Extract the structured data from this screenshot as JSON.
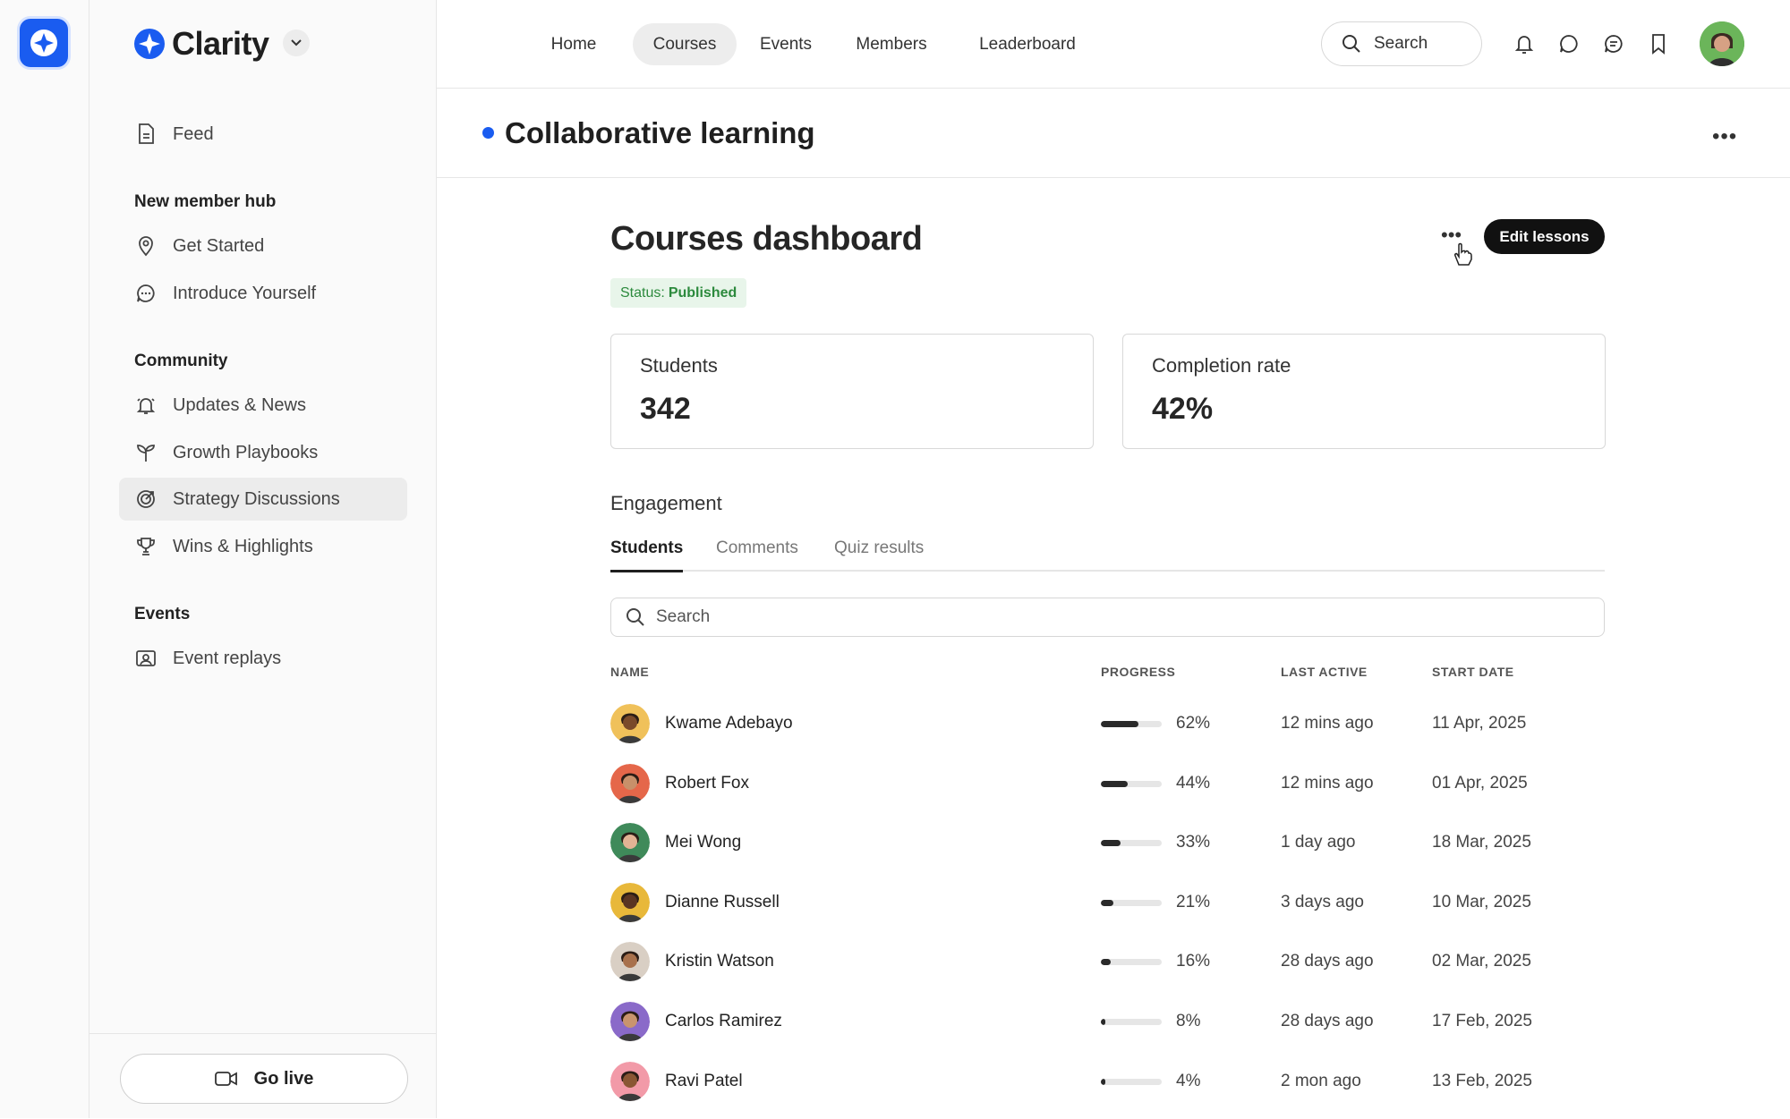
{
  "brand": {
    "name": "Clarity",
    "accent": "#1a5cf0"
  },
  "topnav": {
    "tabs": [
      {
        "label": "Home",
        "active": false
      },
      {
        "label": "Courses",
        "active": true
      },
      {
        "label": "Events",
        "active": false
      },
      {
        "label": "Members",
        "active": false
      },
      {
        "label": "Leaderboard",
        "active": false
      }
    ],
    "search_label": "Search",
    "icons": [
      "bell-icon",
      "chat-icon",
      "messages-icon",
      "bookmark-icon"
    ]
  },
  "sidebar": {
    "feed": "Feed",
    "sections": [
      {
        "title": "New member hub",
        "items": [
          {
            "label": "Get Started",
            "icon": "location-pin-icon"
          },
          {
            "label": "Introduce Yourself",
            "icon": "chat-bubble-icon"
          }
        ]
      },
      {
        "title": "Community",
        "items": [
          {
            "label": "Updates & News",
            "icon": "bell-ring-icon"
          },
          {
            "label": "Growth Playbooks",
            "icon": "sprout-icon"
          },
          {
            "label": "Strategy Discussions",
            "icon": "target-icon",
            "active": true
          },
          {
            "label": "Wins & Highlights",
            "icon": "trophy-icon"
          }
        ]
      },
      {
        "title": "Events",
        "items": [
          {
            "label": "Event replays",
            "icon": "replay-icon"
          }
        ]
      }
    ],
    "go_live": "Go live"
  },
  "page": {
    "title": "Collaborative learning"
  },
  "dashboard": {
    "title": "Courses dashboard",
    "status_prefix": "Status:",
    "status_value": "Published",
    "edit_button": "Edit lessons",
    "stats": [
      {
        "label": "Students",
        "value": "342"
      },
      {
        "label": "Completion rate",
        "value": "42%"
      }
    ],
    "engagement_title": "Engagement",
    "tabs": [
      {
        "label": "Students",
        "active": true
      },
      {
        "label": "Comments",
        "active": false
      },
      {
        "label": "Quiz results",
        "active": false
      }
    ],
    "search_placeholder": "Search",
    "columns": [
      "NAME",
      "PROGRESS",
      "LAST ACTIVE",
      "START DATE"
    ],
    "rows": [
      {
        "name": "Kwame Adebayo",
        "progress": 62,
        "progress_label": "62%",
        "last_active": "12 mins ago",
        "start_date": "11 Apr, 2025",
        "avatar_bg": "#f0c15a",
        "skin": "#7a4a2a"
      },
      {
        "name": "Robert Fox",
        "progress": 44,
        "progress_label": "44%",
        "last_active": "12 mins ago",
        "start_date": "01 Apr, 2025",
        "avatar_bg": "#e5674a",
        "skin": "#c8906a"
      },
      {
        "name": "Mei Wong",
        "progress": 33,
        "progress_label": "33%",
        "last_active": "1 day ago",
        "start_date": "18 Mar, 2025",
        "avatar_bg": "#3f8a5a",
        "skin": "#e2b394"
      },
      {
        "name": "Dianne Russell",
        "progress": 21,
        "progress_label": "21%",
        "last_active": "3 days ago",
        "start_date": "10 Mar, 2025",
        "avatar_bg": "#e8b83a",
        "skin": "#5a3522"
      },
      {
        "name": "Kristin Watson",
        "progress": 16,
        "progress_label": "16%",
        "last_active": "28 days ago",
        "start_date": "02 Mar, 2025",
        "avatar_bg": "#d9cfc4",
        "skin": "#a8714c"
      },
      {
        "name": "Carlos Ramirez",
        "progress": 8,
        "progress_label": "8%",
        "last_active": "28 days ago",
        "start_date": "17 Feb, 2025",
        "avatar_bg": "#8a6ac9",
        "skin": "#c9946e"
      },
      {
        "name": "Ravi Patel",
        "progress": 4,
        "progress_label": "4%",
        "last_active": "2 mon ago",
        "start_date": "13 Feb, 2025",
        "avatar_bg": "#f29aa8",
        "skin": "#8a5633"
      }
    ]
  }
}
